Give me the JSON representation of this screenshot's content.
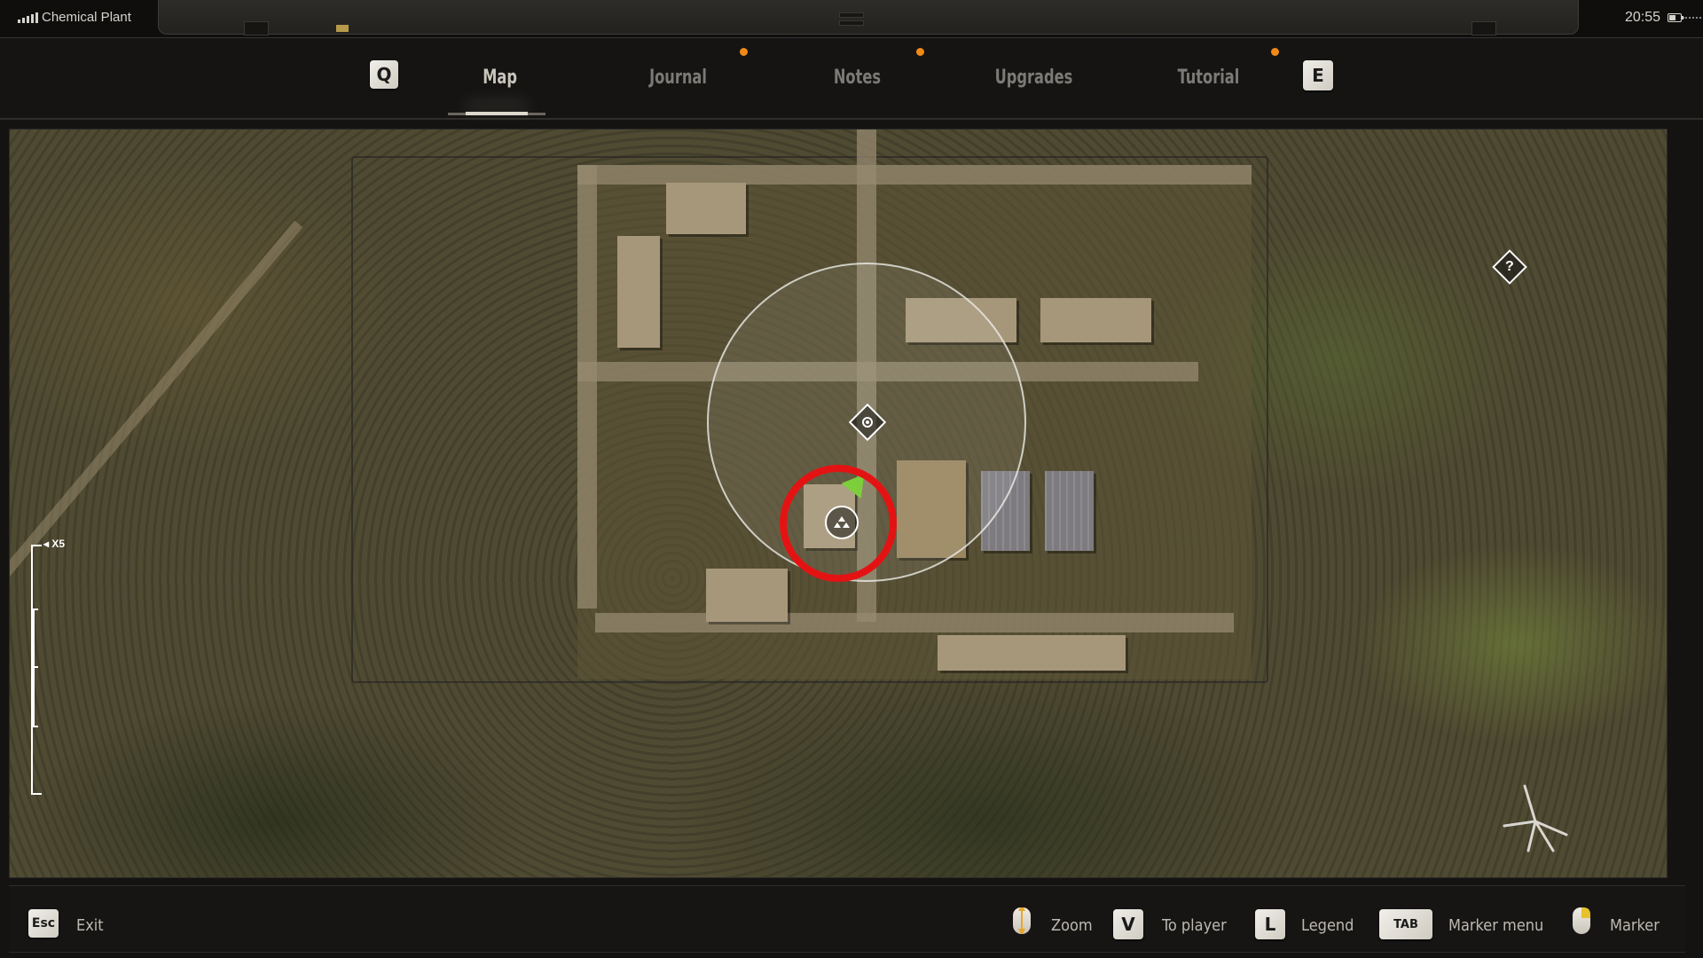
{
  "status_bar": {
    "location": "Chemical Plant",
    "signal_icon": "signal-icon",
    "time": "20:55",
    "battery_icon": "battery-icon"
  },
  "tabs": {
    "prev_key": "Q",
    "next_key": "E",
    "items": [
      {
        "label": "Map",
        "active": true,
        "notification": false
      },
      {
        "label": "Journal",
        "active": false,
        "notification": true
      },
      {
        "label": "Notes",
        "active": false,
        "notification": true
      },
      {
        "label": "Upgrades",
        "active": false,
        "notification": false
      },
      {
        "label": "Tutorial",
        "active": false,
        "notification": true
      }
    ],
    "notification_color": "#f08a17"
  },
  "map": {
    "zoom_level_label": "X5",
    "zoom_level_fraction": 0.5,
    "markers": [
      {
        "type": "player",
        "icon": "player-arrow-icon",
        "color": "#7ccf3b"
      },
      {
        "type": "waypoint",
        "icon": "waypoint-diamond-icon"
      },
      {
        "type": "unknown",
        "icon": "question-diamond-icon",
        "glyph": "?"
      },
      {
        "type": "point-of-interest",
        "icon": "stash-icon"
      },
      {
        "type": "highlight",
        "icon": "red-circle-highlight",
        "color": "#e41313"
      },
      {
        "type": "landmark",
        "icon": "helicopter-wreck-icon"
      }
    ]
  },
  "footer": {
    "exit": {
      "key": "Esc",
      "label": "Exit"
    },
    "hints": [
      {
        "key": "mouse-wheel",
        "label": "Zoom"
      },
      {
        "key": "V",
        "label": "To player"
      },
      {
        "key": "L",
        "label": "Legend"
      },
      {
        "key": "TAB",
        "label": "Marker menu"
      },
      {
        "key": "mouse-right",
        "label": "Marker"
      }
    ]
  }
}
